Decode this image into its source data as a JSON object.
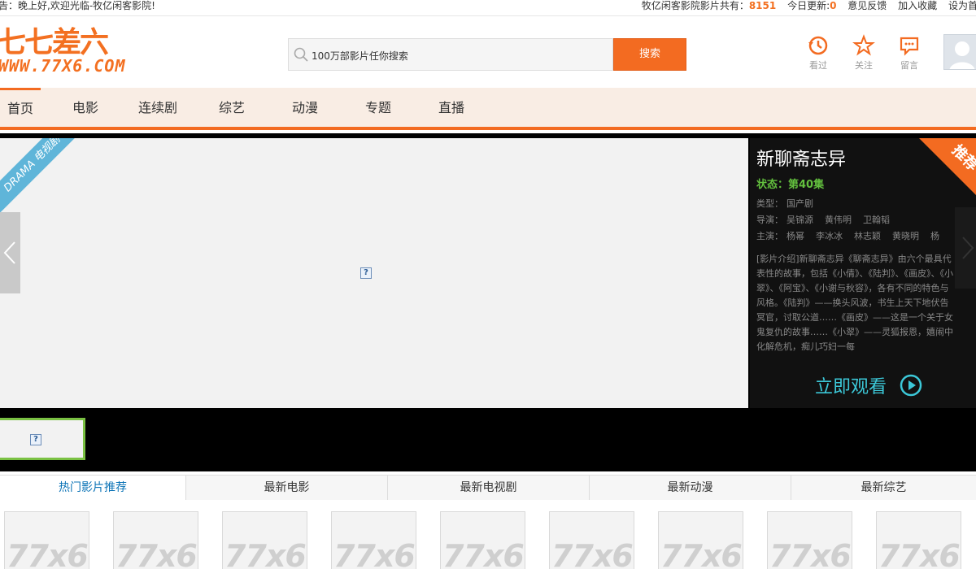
{
  "topbar": {
    "greeting": "告：晚上好,欢迎光临-牧亿闲客影院!",
    "count_prefix": "牧亿闲客影院影片共有：",
    "count": "8151",
    "today_prefix": "今日更新:",
    "today": "0",
    "feedback": "意见反馈",
    "favorite": "加入收藏",
    "set_home": "设为首"
  },
  "logo": {
    "cn": "七七差六",
    "en": "WWW.77X6.COM"
  },
  "search": {
    "placeholder": "100万部影片任你搜索",
    "button": "搜索"
  },
  "header_icons": [
    {
      "label": "看过",
      "icon": "history-icon"
    },
    {
      "label": "关注",
      "icon": "star-icon"
    },
    {
      "label": "留言",
      "icon": "message-icon"
    }
  ],
  "nav": [
    "首页",
    "电影",
    "连续剧",
    "综艺",
    "动漫",
    "专题",
    "直播"
  ],
  "banner": {
    "ribbon": "DRAMA 电视剧",
    "badge": "推荐",
    "title": "新聊斋志异",
    "status_label": "状态：",
    "status_value": "第40集",
    "type_label": "类型：",
    "type_value": "国产剧",
    "director_label": "导演：",
    "directors": [
      "吴锦源",
      "黄伟明",
      "卫翰韬"
    ],
    "cast_label": "主演：",
    "cast": [
      "杨幂",
      "李冰冰",
      "林志颖",
      "黄晓明",
      "杨"
    ],
    "description": "[影片介绍]新聊斋志异《聊斋志异》由六个最具代表性的故事，包括《小倩》、《陆判》、《画皮》、《小翠》、《阿宝》、《小谢与秋容》，各有不同的特色与风格。《陆判》——换头风波，书生上天下地伏告冥官，讨取公道……《画皮》——这是一个关于女鬼复仇的故事……《小翠》——灵狐报恩，嬉闹中化解危机，痴儿巧妇一每",
    "watch": "立即观看",
    "broken_icon": "?"
  },
  "tabs": [
    "热门影片推荐",
    "最新电影",
    "最新电视剧",
    "最新动漫",
    "最新综艺"
  ],
  "poster_watermark": "77x6",
  "poster_count": 9,
  "colors": {
    "accent": "#f36b21",
    "nav_bg": "#f9ede4",
    "status": "#63c03e",
    "watch": "#3cc8d8",
    "tab_active": "#0b73b6"
  }
}
